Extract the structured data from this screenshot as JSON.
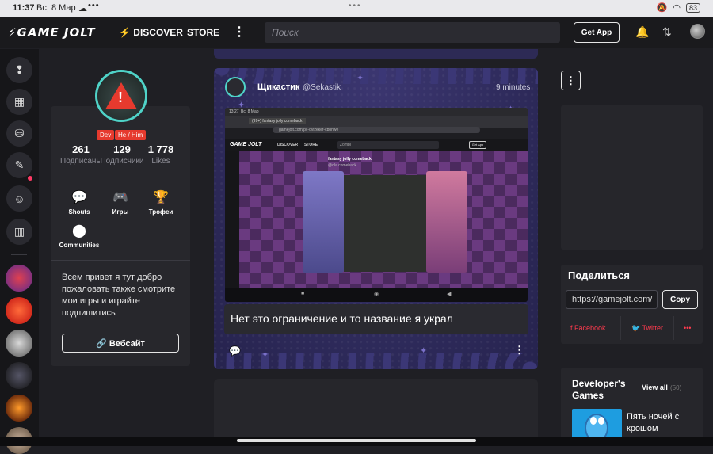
{
  "status": {
    "time": "11:37",
    "date": "Вс, 8 Мар",
    "battery": "83"
  },
  "topbar": {
    "logo": "GAME JOLT",
    "discover": "DISCOVER",
    "store": "STORE",
    "more": "⋮",
    "search_placeholder": "Поиск",
    "get_app": "Get App"
  },
  "profile": {
    "badges": [
      "Dev",
      "He / Him"
    ],
    "stats": [
      {
        "value": "261",
        "label": "Подписаны"
      },
      {
        "value": "129",
        "label": "Подписчики"
      },
      {
        "value": "1 778",
        "label": "Likes"
      }
    ],
    "tiles": [
      {
        "label": "Shouts",
        "icon": "chat-bubble-icon"
      },
      {
        "label": "Игры",
        "icon": "gamepad-icon"
      },
      {
        "label": "Трофеи",
        "icon": "trophy-icon"
      },
      {
        "label": "Communities",
        "icon": "communities-icon"
      }
    ],
    "bio": "Всем привет я тут добро пожаловать также смотрите мои игры и играйте подпишитись",
    "website_label": "Вебсайт"
  },
  "post": {
    "author_name": "Щикастик",
    "author_handle": "@Sekastik",
    "time": "9 minutes",
    "caption": "Нет это ограничение и то название я украл",
    "screenshot": {
      "time": "13:27",
      "date": "Вс, 8 Мар",
      "tab_title": "(99+) fantasy jolly comeback",
      "url": "gamejolt.com/p/j-dvlzekef-cbnhwe",
      "logo": "GAME JOLT",
      "discover": "DISCOVER",
      "store": "STORE",
      "search": "Zombi",
      "get_app": "Get App",
      "post_title": "fantasy jolly comeback",
      "post_handle": "@dla.comeback"
    }
  },
  "sidebar": {
    "share_title": "Поделиться",
    "share_url": "https://gamejolt.com/",
    "copy_label": "Copy",
    "facebook": "Facebook",
    "twitter": "Twitter",
    "more": "•••",
    "dev_games_title": "Developer's Games",
    "view_all": "View all",
    "view_all_count": "(50)",
    "game_title": "Пять ночей с крошом"
  }
}
